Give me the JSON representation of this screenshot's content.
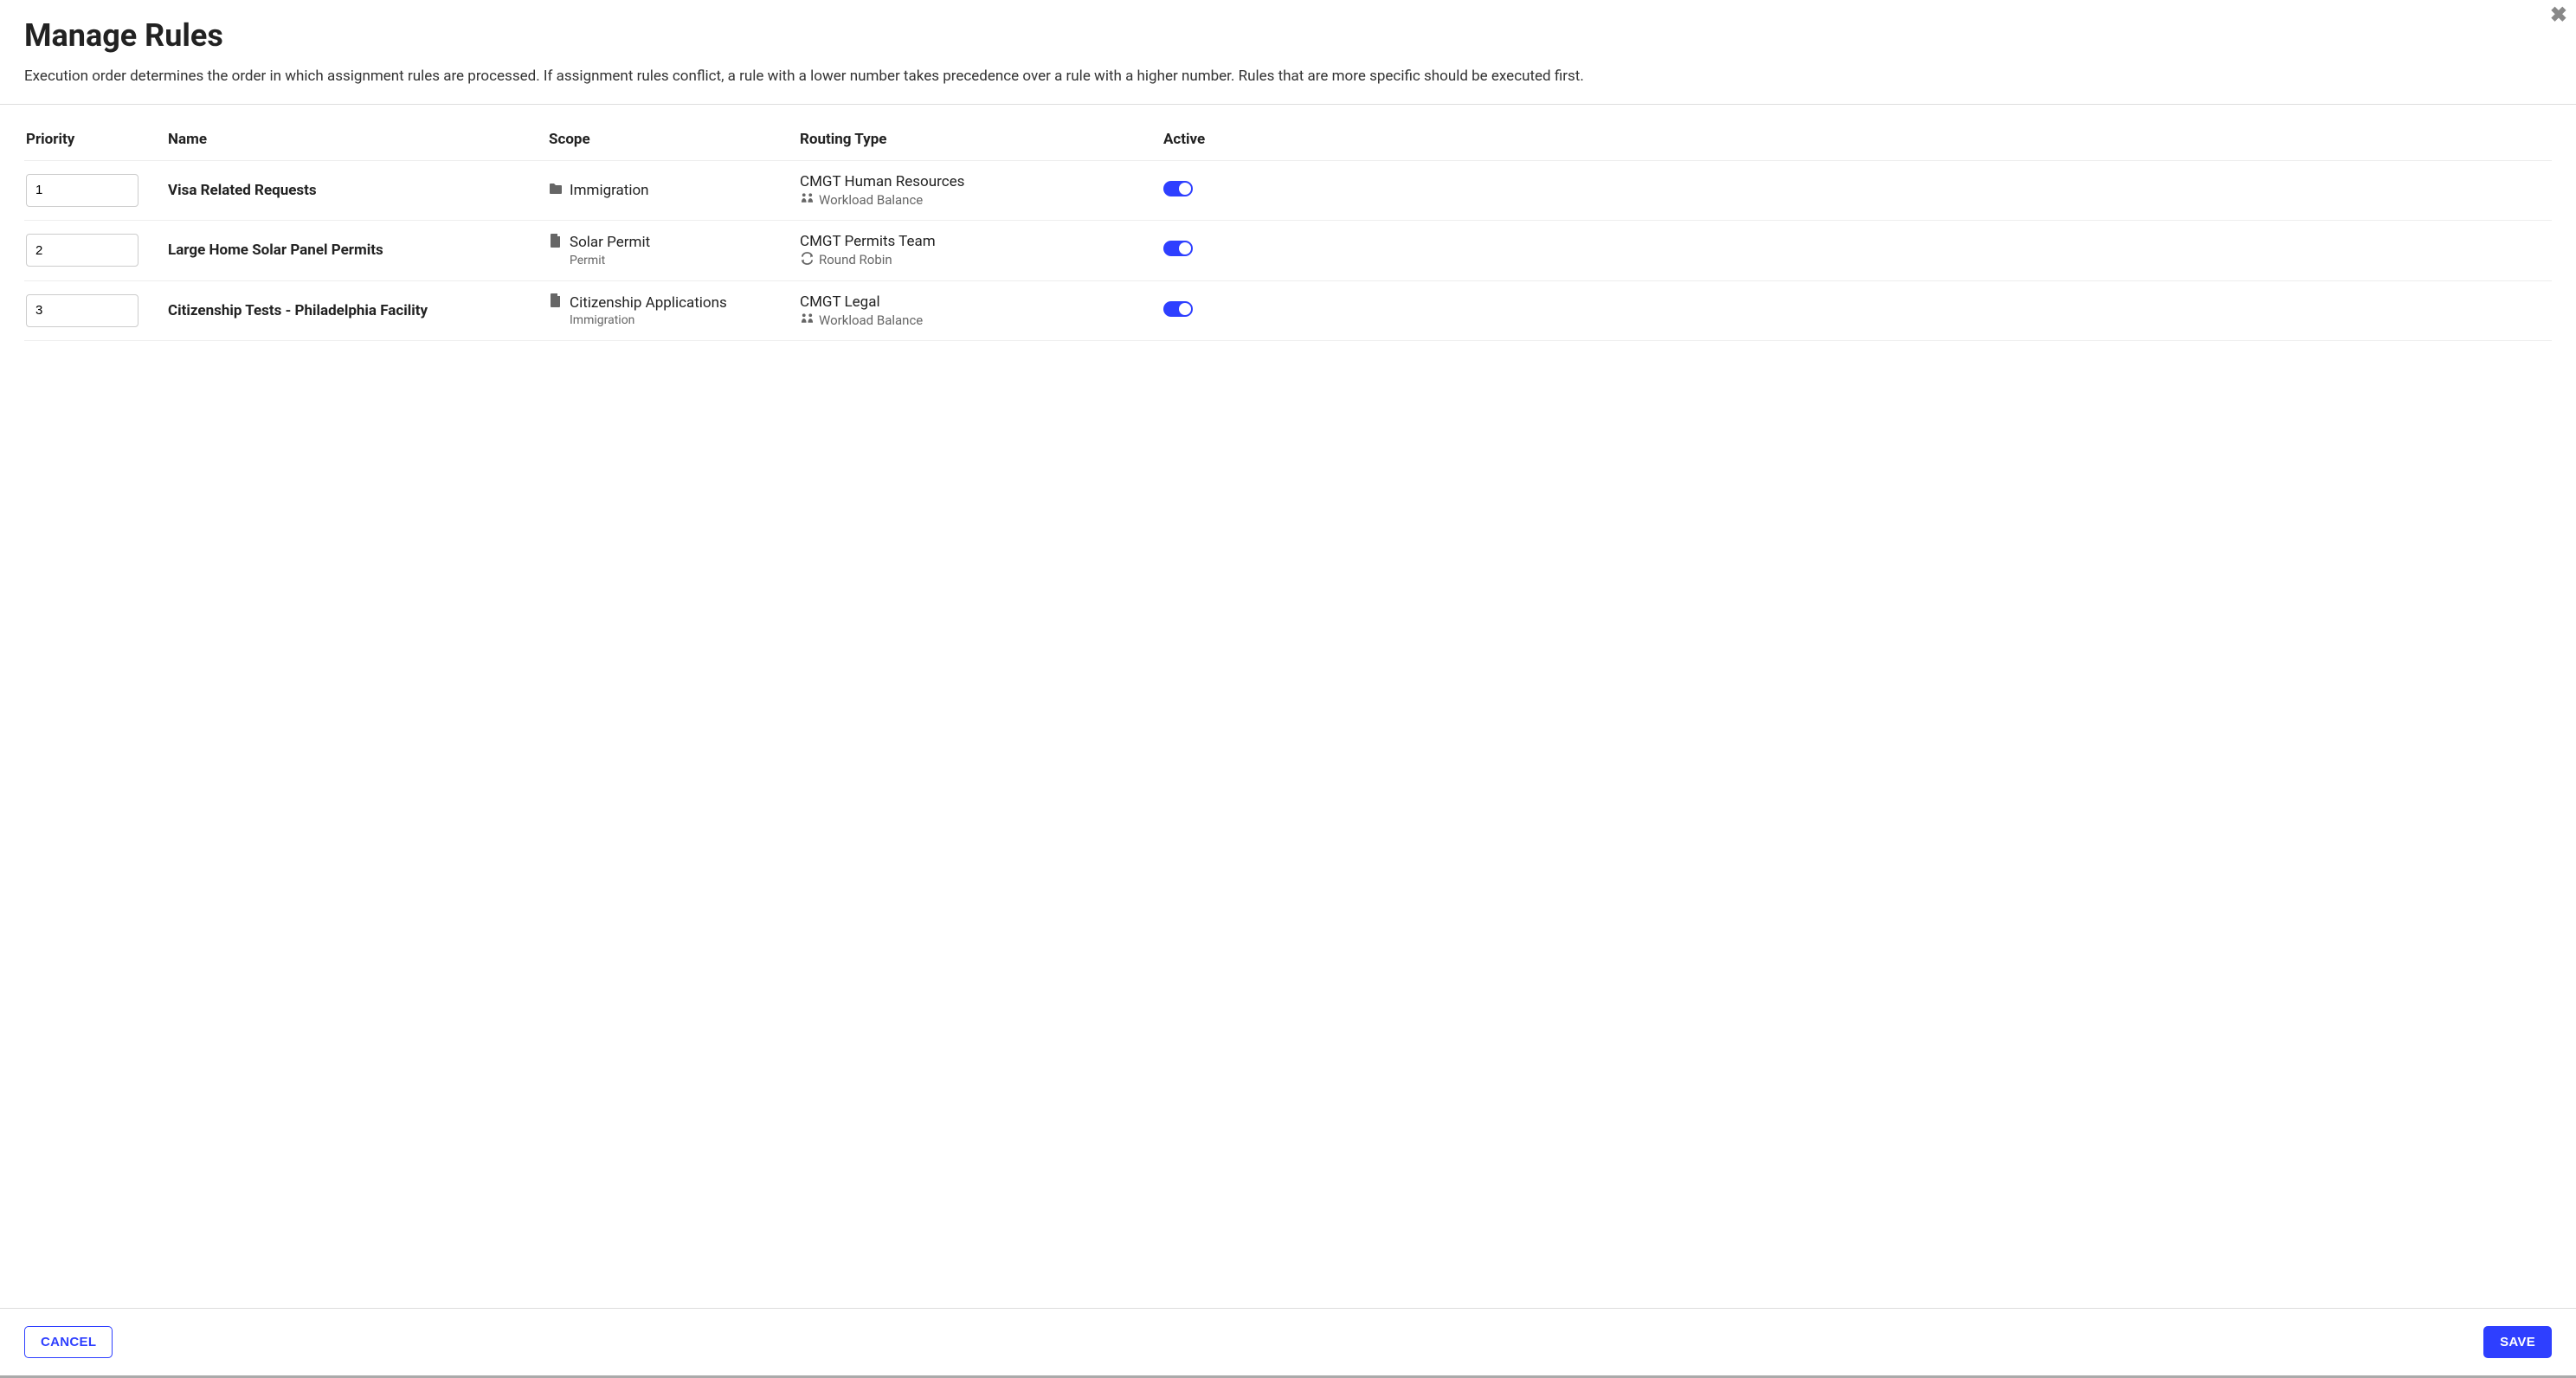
{
  "title": "Manage Rules",
  "description": "Execution order determines the order in which assignment rules are processed. If assignment rules conflict, a rule with a lower number takes precedence over a rule with a higher number. Rules that are more specific should be executed first.",
  "columns": {
    "priority": "Priority",
    "name": "Name",
    "scope": "Scope",
    "routing_type": "Routing Type",
    "active": "Active"
  },
  "rows": [
    {
      "priority": "1",
      "name": "Visa Related Requests",
      "scope_icon": "folder",
      "scope_main": "Immigration",
      "scope_sub": "",
      "routing_team": "CMGT Human Resources",
      "routing_mode_icon": "workload",
      "routing_mode": "Workload Balance",
      "active": true
    },
    {
      "priority": "2",
      "name": "Large Home Solar Panel Permits",
      "scope_icon": "file",
      "scope_main": "Solar Permit",
      "scope_sub": "Permit",
      "routing_team": "CMGT Permits Team",
      "routing_mode_icon": "roundrobin",
      "routing_mode": "Round Robin",
      "active": true
    },
    {
      "priority": "3",
      "name": "Citizenship Tests - Philadelphia Facility",
      "scope_icon": "file",
      "scope_main": "Citizenship Applications",
      "scope_sub": "Immigration",
      "routing_team": "CMGT Legal",
      "routing_mode_icon": "workload",
      "routing_mode": "Workload Balance",
      "active": true
    }
  ],
  "buttons": {
    "cancel": "CANCEL",
    "save": "SAVE"
  }
}
